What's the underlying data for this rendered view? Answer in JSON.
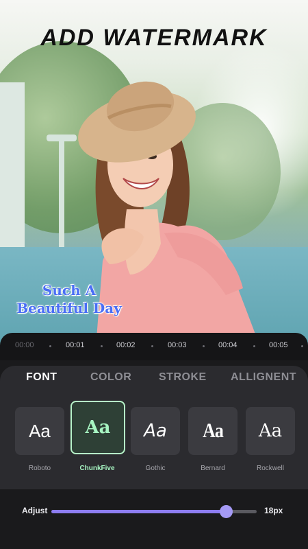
{
  "header": {
    "title": "ADD WATERMARK"
  },
  "watermark": {
    "line1": "Such A",
    "line2": "Beautiful Day"
  },
  "timeline": {
    "ticks": [
      "00:00",
      "00:01",
      "00:02",
      "00:03",
      "00:04",
      "00:05"
    ]
  },
  "tabs": [
    {
      "label": "FONT",
      "active": true
    },
    {
      "label": "COLOR",
      "active": false
    },
    {
      "label": "STROKE",
      "active": false
    },
    {
      "label": "ALLIGNENT",
      "active": false
    }
  ],
  "fonts": [
    {
      "sample": "Aa",
      "name": "Roboto",
      "selected": false
    },
    {
      "sample": "Aa",
      "name": "ChunkFive",
      "selected": true
    },
    {
      "sample": "Aa",
      "name": "Gothic",
      "selected": false
    },
    {
      "sample": "Aa",
      "name": "Bernard",
      "selected": false
    },
    {
      "sample": "Aa",
      "name": "Rockwell",
      "selected": false
    }
  ],
  "adjust": {
    "label": "Adjust",
    "value": "18px",
    "fraction": 0.85
  },
  "colors": {
    "accent": "#8d7df0",
    "selected_font": "#a7f5c2",
    "watermark_text": "#4a6ef5"
  }
}
